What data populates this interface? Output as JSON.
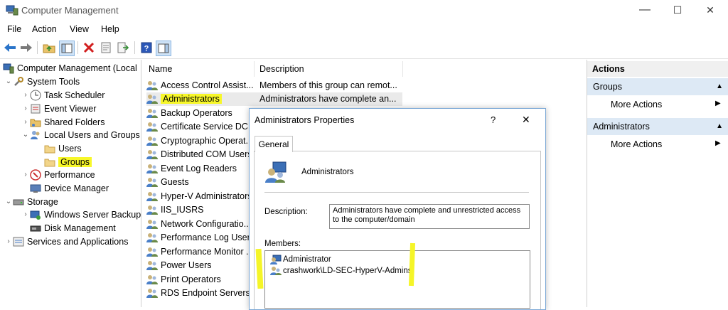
{
  "window": {
    "title": "Computer Management",
    "minimize": "—",
    "maximize": "☐",
    "close": "✕"
  },
  "menu": [
    "File",
    "Action",
    "View",
    "Help"
  ],
  "tree": {
    "root": "Computer Management (Local",
    "system_tools": "System Tools",
    "task_scheduler": "Task Scheduler",
    "event_viewer": "Event Viewer",
    "shared_folders": "Shared Folders",
    "local_users_groups": "Local Users and Groups",
    "users": "Users",
    "groups": "Groups",
    "performance": "Performance",
    "device_manager": "Device Manager",
    "storage": "Storage",
    "windows_server_backup": "Windows Server Backup",
    "disk_management": "Disk Management",
    "services_apps": "Services and Applications"
  },
  "list": {
    "col_name": "Name",
    "col_description": "Description",
    "rows": [
      {
        "name": "Access Control Assist...",
        "description": "Members of this group can remot..."
      },
      {
        "name": "Administrators",
        "description": "Administrators have complete an..."
      },
      {
        "name": "Backup Operators",
        "description": ""
      },
      {
        "name": "Certificate Service DC...",
        "description": ""
      },
      {
        "name": "Cryptographic Operat...",
        "description": ""
      },
      {
        "name": "Distributed COM Users",
        "description": ""
      },
      {
        "name": "Event Log Readers",
        "description": ""
      },
      {
        "name": "Guests",
        "description": ""
      },
      {
        "name": "Hyper-V Administrators",
        "description": ""
      },
      {
        "name": "IIS_IUSRS",
        "description": ""
      },
      {
        "name": "Network Configuratio...",
        "description": ""
      },
      {
        "name": "Performance Log Users",
        "description": ""
      },
      {
        "name": "Performance Monitor ...",
        "description": ""
      },
      {
        "name": "Power Users",
        "description": ""
      },
      {
        "name": "Print Operators",
        "description": ""
      },
      {
        "name": "RDS Endpoint Servers",
        "description": ""
      }
    ]
  },
  "actions": {
    "header": "Actions",
    "sections": [
      {
        "title": "Groups",
        "item": "More Actions"
      },
      {
        "title": "Administrators",
        "item": "More Actions"
      }
    ]
  },
  "dialog": {
    "title": "Administrators Properties",
    "help": "?",
    "close": "✕",
    "tab": "General",
    "group_name": "Administrators",
    "description_label": "Description:",
    "description_value": "Administrators have complete and unrestricted access to the computer/domain",
    "members_label": "Members:",
    "members": [
      "Administrator",
      "crashwork\\LD-SEC-HyperV-Admins"
    ]
  }
}
